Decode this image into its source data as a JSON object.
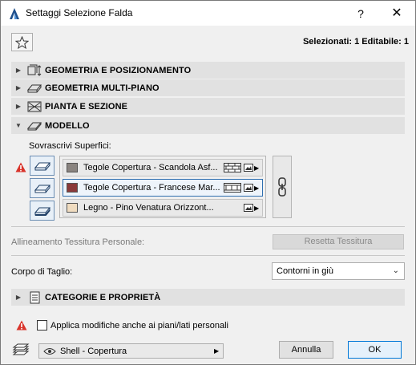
{
  "window": {
    "title": "Settaggi Selezione Falda",
    "help_label": "?",
    "close_label": "✕"
  },
  "header": {
    "selection_info": "Selezionati: 1 Editabile: 1"
  },
  "sections": [
    {
      "label": "GEOMETRIA E POSIZIONAMENTO",
      "expanded": false,
      "icon": "geometry-icon"
    },
    {
      "label": "GEOMETRIA MULTI-PIANO",
      "expanded": false,
      "icon": "multi-plane-icon"
    },
    {
      "label": "PIANTA E SEZIONE",
      "expanded": false,
      "icon": "plan-section-icon"
    },
    {
      "label": "MODELLO",
      "expanded": true,
      "icon": "model-icon"
    }
  ],
  "model": {
    "override_label": "Sovrascrivi Superfici:",
    "surfaces": [
      {
        "name": "Tegole Copertura - Scandola Asf...",
        "color": "#8a8480",
        "selected": false,
        "hatch": "brick-hatch-icon"
      },
      {
        "name": "Tegole Copertura - Francese Mar...",
        "color": "#8a3a3a",
        "selected": true,
        "hatch": "tile-hatch-icon"
      },
      {
        "name": "Legno - Pino Venatura Orizzont...",
        "color": "#f0dcc0",
        "selected": false,
        "hatch": ""
      }
    ],
    "alignment_label": "Allineamento Tessitura Personale:",
    "reset_label": "Resetta Tessitura",
    "cut_body_label": "Corpo di Taglio:",
    "cut_body_value": "Contorni in giù"
  },
  "categories": {
    "label": "CATEGORIE E PROPRIETÀ",
    "expanded": false
  },
  "footer": {
    "apply_label": "Applica modifiche anche ai piani/lati personali",
    "apply_checked": false,
    "layer_value": "Shell - Copertura",
    "cancel_label": "Annulla",
    "ok_label": "OK"
  },
  "colors": {
    "accent": "#0078d7",
    "warning": "#d9342b",
    "section_bg": "#e1e1e1"
  }
}
